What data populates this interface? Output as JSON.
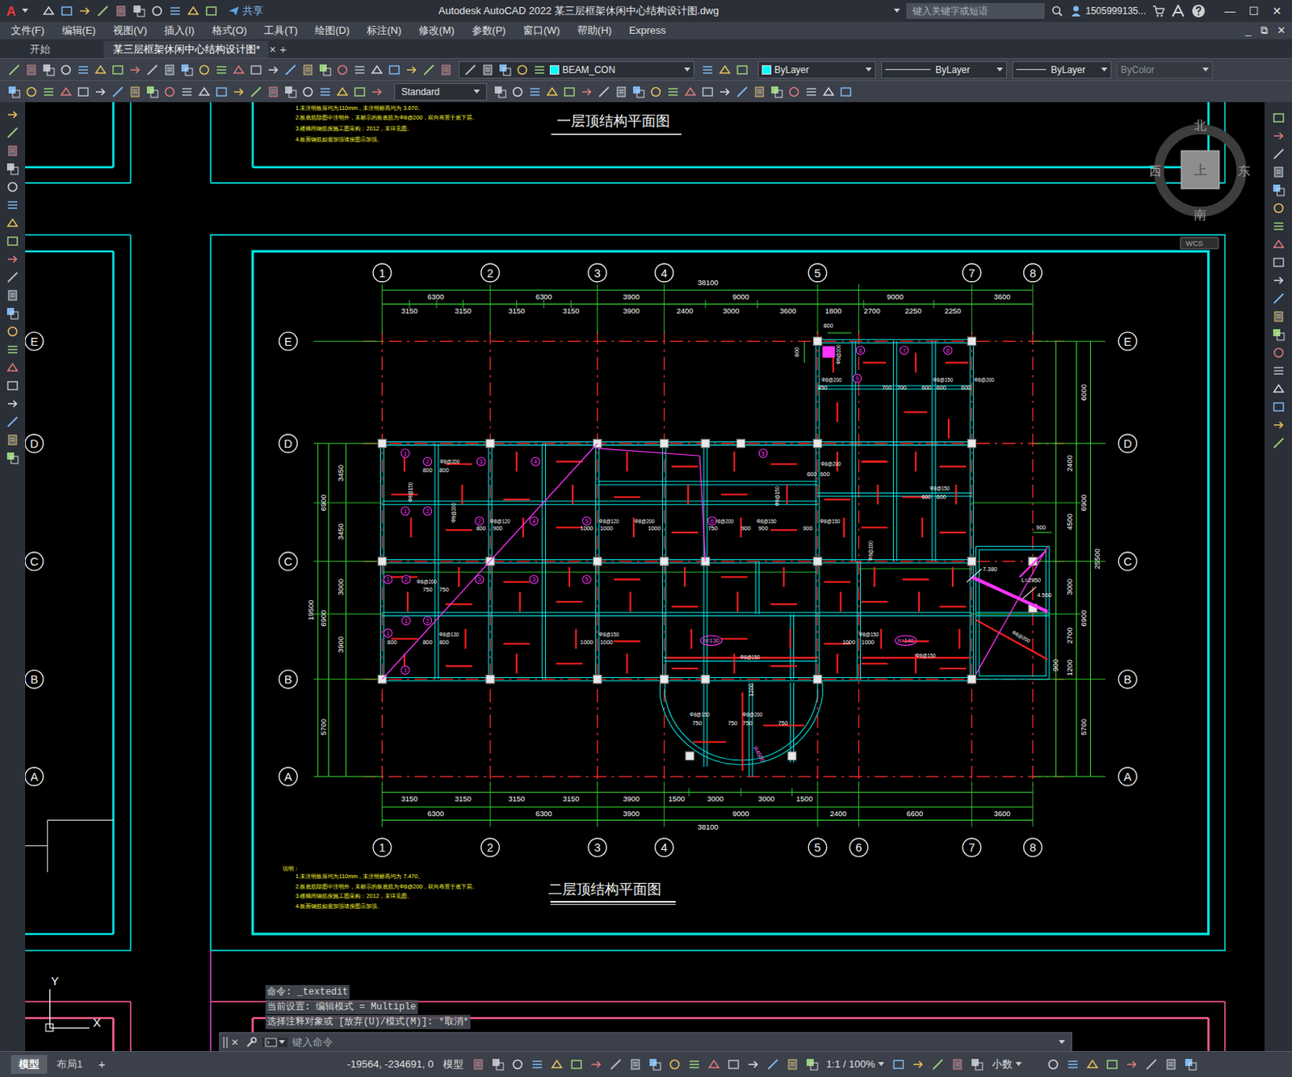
{
  "window": {
    "app_icon": "A",
    "title": "Autodesk AutoCAD 2022    某三层框架休闲中心结构设计图.dwg",
    "share": "共享",
    "search": {
      "placeholder": "键入关键字或短语"
    },
    "user": "1505999135...",
    "controls": [
      "—",
      "☐",
      "✕"
    ],
    "doc_controls": [
      "_",
      "⧉",
      "✕"
    ]
  },
  "menu": [
    "文件(F)",
    "编辑(E)",
    "视图(V)",
    "插入(I)",
    "格式(O)",
    "工具(T)",
    "绘图(D)",
    "标注(N)",
    "修改(M)",
    "参数(P)",
    "窗口(W)",
    "帮助(H)",
    "Express"
  ],
  "file_tabs": [
    {
      "label": "开始",
      "selected": false
    },
    {
      "label": "某三层框架休闲中心结构设计图*",
      "selected": true
    }
  ],
  "file_tab_close": "×",
  "new_tab": "+",
  "properties": {
    "layer": "BEAM_CON",
    "color": "ByLayer",
    "linetype": "ByLayer",
    "lineweight": "ByLayer",
    "plotstyle": "ByColor"
  },
  "text_style": "Standard",
  "viewcube": {
    "north": "北",
    "south": "南",
    "east": "东",
    "west": "西",
    "face": "上",
    "ucs": "WCS"
  },
  "drawing": {
    "plan1": {
      "title": "一层顶结构平面图",
      "notes": [
        "1.未注明板厚均为110mm，未注明标高均为 3.670。",
        "2.板底筋除图中注明外，未标示的板底筋为Φ8@200，双向布置于底下层。",
        "3.楼梯间钢筋按施工图采购：2012，未详见图。",
        "4.板面钢筋如需加强请按图示加强。"
      ]
    },
    "plan2": {
      "title": "二层顶结构平面图",
      "notes_heading": "说明：",
      "notes": [
        "1.未注明板厚均为110mm，未注明标高均为 7.470。",
        "2.板底筋除图中注明外，未标示的板底筋为Φ8@200，双向布置于底下层。",
        "3.楼梯间钢筋按施工图采购：2012，未详见图。",
        "4.板面钢筋如需加强请按图示加强。"
      ]
    },
    "axes_top": [
      "1",
      "2",
      "3",
      "4",
      "5",
      "7",
      "8"
    ],
    "axes_bottom": [
      "1",
      "2",
      "3",
      "4",
      "5",
      "6",
      "7",
      "8"
    ],
    "axes_rows": [
      "E",
      "D",
      "C",
      "B",
      "A"
    ],
    "adjacent_axes": [
      "E",
      "D",
      "C",
      "B",
      "A"
    ],
    "dim_total_top": "38100",
    "dims_top_1": [
      "6300",
      "6300",
      "3900",
      "9000",
      "9000",
      "3600"
    ],
    "dims_top_2": [
      "3150",
      "3150",
      "3150",
      "3150",
      "3900",
      "2400",
      "3000",
      "3600",
      "1800",
      "2700",
      "2250",
      "2250"
    ],
    "dims_bottom_1": [
      "3150",
      "3150",
      "3150",
      "3150",
      "3900",
      "1500",
      "3000",
      "3000",
      "1500"
    ],
    "dims_bottom_2": [
      "6300",
      "6300",
      "3900",
      "9000",
      "2400",
      "6600",
      "3600"
    ],
    "dim_total_bottom": "38100",
    "dims_left": [
      "3450",
      "3450",
      "6900",
      "3000",
      "3900",
      "6900",
      "19500",
      "5700"
    ],
    "dims_right": [
      "6000",
      "2400",
      "6900",
      "4500",
      "3000",
      "25500",
      "2700",
      "6900",
      "1200",
      "5700",
      "900"
    ],
    "bay_labels": [
      "800",
      "800",
      "900",
      "800",
      "800",
      "800",
      "900",
      "1000",
      "1000",
      "1000",
      "750",
      "900",
      "900",
      "900",
      "750",
      "750",
      "800",
      "800",
      "800",
      "1000",
      "1000",
      "750",
      "750",
      "750",
      "750",
      "1000",
      "1000",
      "600",
      "600",
      "600",
      "600",
      "700",
      "700",
      "600",
      "600",
      "600",
      "450",
      "1200"
    ],
    "rebar_labels": [
      "Φ8@200",
      "Φ8@150",
      "Φ8@120",
      "Φ8@120",
      "Φ8@200",
      "Φ8@200",
      "Φ8@150",
      "Φ8@150",
      "Φ8@200",
      "Φ8@200",
      "Φ8@150",
      "Φ8@200",
      "Φ8@150",
      "Φ8@200",
      "Φ8@200",
      "Φ8@130",
      "Φ8@150",
      "Φ8@150",
      "Φ8@150",
      "Φ8@150",
      "Φ8@150",
      "Φ8@200",
      "Φ8@200",
      "Φ8@200",
      "Φ8@150",
      "Φ8@200"
    ],
    "special_labels": [
      "R4500",
      "h=130",
      "h=140",
      "7.380",
      "4.560",
      "L=2950"
    ],
    "slab_marks": [
      "1",
      "2",
      "3",
      "4",
      "1",
      "2",
      "2",
      "4",
      "5",
      "1",
      "2",
      "3",
      "3",
      "5",
      "1",
      "2",
      "1",
      "1",
      "6",
      "7",
      "8",
      "9",
      "5",
      "6"
    ]
  },
  "ucs": {
    "x": "X",
    "y": "Y"
  },
  "command_history": [
    "命令: _textedit",
    "当前设置: 编辑模式 = Multiple",
    "选择注释对象或 [放弃(U)/模式(M)]: *取消*"
  ],
  "command_close": "✕",
  "command_input": {
    "placeholder": "键入命令"
  },
  "layout_tabs": [
    {
      "label": "模型",
      "selected": true
    },
    {
      "label": "布局1",
      "selected": false
    }
  ],
  "add_layout": "+",
  "status_bar": {
    "coords": "-19564, -234691, 0",
    "space": "模型",
    "scale": "1:1 / 100%",
    "units": "小数"
  }
}
